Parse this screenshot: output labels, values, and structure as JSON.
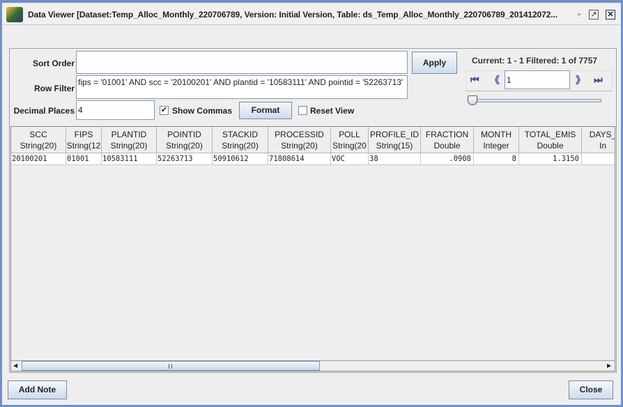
{
  "window": {
    "title": "Data Viewer [Dataset:Temp_Alloc_Monthly_220706789, Version: Initial Version, Table: ds_Temp_Alloc_Monthly_220706789_201412072...",
    "minimize_icon": "restore-icon",
    "maximize_icon": "maximize-icon",
    "close_icon": "close-icon"
  },
  "controls": {
    "sort_order_label": "Sort Order",
    "sort_order_value": "",
    "row_filter_label": "Row Filter",
    "row_filter_value": "fips = '01001' AND scc = '20100201' AND plantid = '10583111' AND pointid = '52263713'",
    "decimal_places_label": "Decimal Places",
    "decimal_places_value": "4",
    "show_commas_label": "Show Commas",
    "show_commas_checked": true,
    "format_label": "Format",
    "reset_view_label": "Reset View",
    "reset_view_checked": false,
    "apply_label": "Apply"
  },
  "paging": {
    "status": "Current: 1 - 1 Filtered: 1 of 7757",
    "page_value": "1",
    "slider_position": 0
  },
  "table": {
    "columns": [
      {
        "name": "SCC",
        "type": "String(20)"
      },
      {
        "name": "FIPS",
        "type": "String(12"
      },
      {
        "name": "PLANTID",
        "type": "String(20)"
      },
      {
        "name": "POINTID",
        "type": "String(20)"
      },
      {
        "name": "STACKID",
        "type": "String(20)"
      },
      {
        "name": "PROCESSID",
        "type": "String(20)"
      },
      {
        "name": "POLL",
        "type": "String(20"
      },
      {
        "name": "PROFILE_ID",
        "type": "String(15)"
      },
      {
        "name": "FRACTION",
        "type": "Double"
      },
      {
        "name": "MONTH",
        "type": "Integer"
      },
      {
        "name": "TOTAL_EMIS",
        "type": "Double"
      },
      {
        "name": "DAYS_",
        "type": "In"
      }
    ],
    "rows": [
      [
        "20100201",
        "01001",
        "10583111",
        "52263713",
        "50910612",
        "71808614",
        "VOC",
        "38",
        ".0908",
        "8",
        "1.3150",
        ""
      ]
    ]
  },
  "footer": {
    "add_note_label": "Add Note",
    "close_label": "Close"
  }
}
